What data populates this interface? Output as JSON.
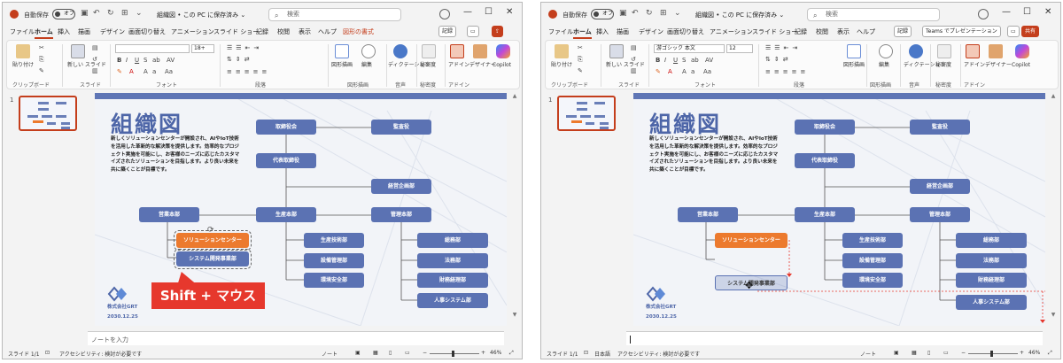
{
  "app": {
    "autosave_label": "自動保存",
    "autosave_state": "オフ",
    "doc_title": "組織図 • この PC に保存済み ⌄",
    "search_placeholder": "検索",
    "accent_color": "#c43e1c"
  },
  "tabs": [
    "ファイル",
    "ホーム",
    "挿入",
    "描画",
    "デザイン",
    "画面切り替え",
    "アニメーション",
    "スライド ショー",
    "記録",
    "校閲",
    "表示",
    "ヘルプ"
  ],
  "context_tab": "図形の書式",
  "tab_right": {
    "record": "記録",
    "teams": "Teams でプレゼンテーション",
    "share": "共有"
  },
  "ribbon": {
    "paste": "貼り付け",
    "new_slide": "新しい スライド",
    "shapes": "図形描画",
    "edit": "編集",
    "dictate": "ディクテーション",
    "sensitivity": "秘密度",
    "addins": "アドイン",
    "designer": "デザイナー",
    "copilot": "Copilot",
    "font_left": "",
    "font_right": "游ゴシック 本文",
    "size_left": "18+",
    "size_right": "12",
    "groups": [
      "クリップボード",
      "スライド",
      "フォント",
      "段落",
      "図形描画",
      "音声",
      "秘密度",
      "アドイン"
    ]
  },
  "slide": {
    "number": "1",
    "title": "組織図",
    "description": "新しくソリューションセンターが開設され、AIやIoT技術を活用した革新的な解決策を提供します。効率的なプロジェクト実施を可能にし、お客様のニーズに応じたカスタマイズされたソリューションを目指します。より良い未来を共に築くことが目標です。",
    "company": "株式会社GRT",
    "date": "2030.12.25",
    "boxes": {
      "board": "取締役会",
      "auditor": "監査役",
      "president": "代表取締役",
      "planning": "経営企画部",
      "sales": "営業本部",
      "production": "生産本部",
      "admin": "管理本部",
      "solution": "ソリューションセンター",
      "sysdev": "システム開発事業部",
      "prodtech": "生産技術部",
      "equipment": "設備管理部",
      "environment": "環境安全部",
      "general": "総務部",
      "legal": "法務部",
      "finance": "財務経理部",
      "hr": "人事システム部"
    }
  },
  "annotation": "Shift + マウス",
  "notes_placeholder": "ノートを入力",
  "status": {
    "slide": "スライド 1/1",
    "language": "日本語",
    "accessibility": "アクセシビリティ: 検討が必要です",
    "notes": "ノート",
    "zoom": "46%"
  }
}
